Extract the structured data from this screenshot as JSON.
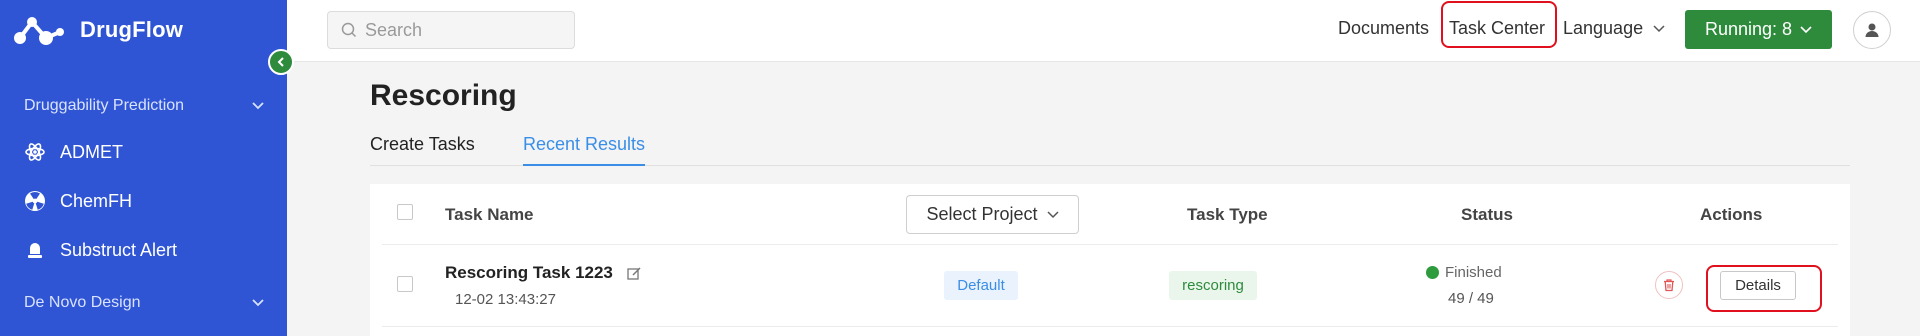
{
  "app": {
    "name": "DrugFlow"
  },
  "sidebar": {
    "sections": [
      {
        "label": "Druggability Prediction",
        "icon": "chevron-down-icon"
      },
      {
        "label": "De Novo Design",
        "icon": "chevron-down-icon"
      }
    ],
    "items": [
      {
        "label": "ADMET",
        "icon": "atom-icon"
      },
      {
        "label": "ChemFH",
        "icon": "radiation-icon"
      },
      {
        "label": "Substruct Alert",
        "icon": "alert-bell-icon"
      }
    ]
  },
  "header": {
    "search_placeholder": "Search",
    "documents": "Documents",
    "task_center": "Task Center",
    "language": "Language",
    "running": "Running: 8"
  },
  "main": {
    "title": "Rescoring",
    "tabs": [
      {
        "label": "Create Tasks",
        "active": false
      },
      {
        "label": "Recent Results",
        "active": true
      }
    ],
    "table": {
      "columns": {
        "task_name": "Task Name",
        "select_project": "Select Project",
        "task_type": "Task Type",
        "status": "Status",
        "actions": "Actions"
      },
      "rows": [
        {
          "name": "Rescoring Task 1223",
          "time": "12-02 13:43:27",
          "project": "Default",
          "type": "rescoring",
          "status": "Finished",
          "progress": "49 / 49",
          "action": "Details"
        }
      ]
    }
  },
  "colors": {
    "sidebar": "#2f55d4",
    "primary_green": "#2e8b3c",
    "accent_blue": "#3a8ee6",
    "highlight_red": "#e0101e"
  }
}
